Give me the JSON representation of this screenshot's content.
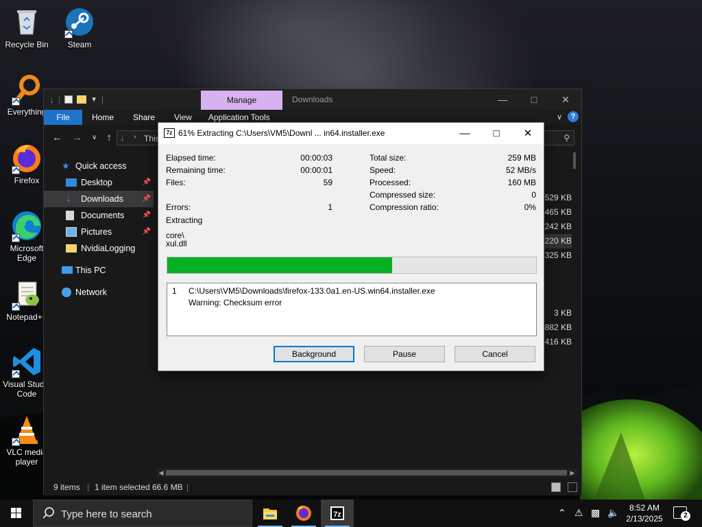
{
  "desktop": {
    "icons": [
      {
        "label": "Recycle Bin",
        "icon": "recycle-bin-icon"
      },
      {
        "label": "Steam",
        "icon": "steam-icon"
      },
      {
        "label": "Everything",
        "icon": "everything-icon"
      },
      {
        "label": "Firefox",
        "icon": "firefox-icon"
      },
      {
        "label": "Microsoft Edge",
        "icon": "edge-icon"
      },
      {
        "label": "Notepad++",
        "icon": "notepadpp-icon"
      },
      {
        "label": "Visual Studio Code",
        "icon": "vscode-icon"
      },
      {
        "label": "VLC media player",
        "icon": "vlc-icon"
      }
    ],
    "labels": {
      "recycle": "Recycle Bin",
      "steam": "Steam",
      "everything": "Everything",
      "firefox": "Firefox",
      "edge_1": "Microsoft",
      "edge_2": "Edge",
      "notepad": "Notepad++",
      "vscode_1": "Visual Studio",
      "vscode_2": "Code",
      "vlc_1": "VLC media",
      "vlc_2": "player"
    }
  },
  "explorer": {
    "title": "Downloads",
    "context_tab": "Manage",
    "ribbon_tabs": {
      "file": "File",
      "home": "Home",
      "share": "Share",
      "view": "View",
      "app_tools": "Application Tools"
    },
    "address": "This",
    "help": "?",
    "nav": {
      "quick_access": "Quick access",
      "desktop": "Desktop",
      "downloads": "Downloads",
      "documents": "Documents",
      "pictures": "Pictures",
      "nvidia": "NvidiaLogging",
      "this_pc": "This PC",
      "network": "Network"
    },
    "file_sizes": [
      "529 KB",
      "465 KB",
      "242 KB",
      "220 KB",
      "325 KB",
      "",
      "",
      "",
      "3 KB",
      "882 KB",
      "416 KB"
    ],
    "status": {
      "items": "9 items",
      "selected": "1 item selected",
      "size": "66.6 MB"
    }
  },
  "dialog": {
    "title": "61% Extracting C:\\Users\\VM5\\Downl ... in64.installer.exe",
    "logo": "7z",
    "left": {
      "elapsed_label": "Elapsed time:",
      "elapsed": "00:00:03",
      "remaining_label": "Remaining time:",
      "remaining": "00:00:01",
      "files_label": "Files:",
      "files": "59",
      "errors_label": "Errors:",
      "errors": "1"
    },
    "right": {
      "total_label": "Total size:",
      "total": "259 MB",
      "speed_label": "Speed:",
      "speed": "52 MB/s",
      "processed_label": "Processed:",
      "processed": "160 MB",
      "compressed_label": "Compressed size:",
      "compressed": "0",
      "ratio_label": "Compression ratio:",
      "ratio": "0%"
    },
    "operation": "Extracting",
    "current_dir": "core\\",
    "current_file": "xul.dll",
    "progress": 0.61,
    "messages": [
      {
        "num": "1",
        "path": "C:\\Users\\VM5\\Downloads\\firefox-133.0a1.en-US.win64.installer.exe",
        "warning": "Warning: Checksum error"
      }
    ],
    "buttons": {
      "background": "Background",
      "pause": "Pause",
      "cancel": "Cancel"
    }
  },
  "taskbar": {
    "search_placeholder": "Type here to search",
    "apps": [
      "file-explorer-icon",
      "firefox-icon",
      "7zip-icon"
    ],
    "time": "8:52 AM",
    "date": "2/13/2025",
    "notifications": "2"
  },
  "colors": {
    "accent": "#0078d7",
    "progress": "#06b025",
    "manage_tab": "#d6b3f0",
    "file_tab": "#1e73c9"
  }
}
